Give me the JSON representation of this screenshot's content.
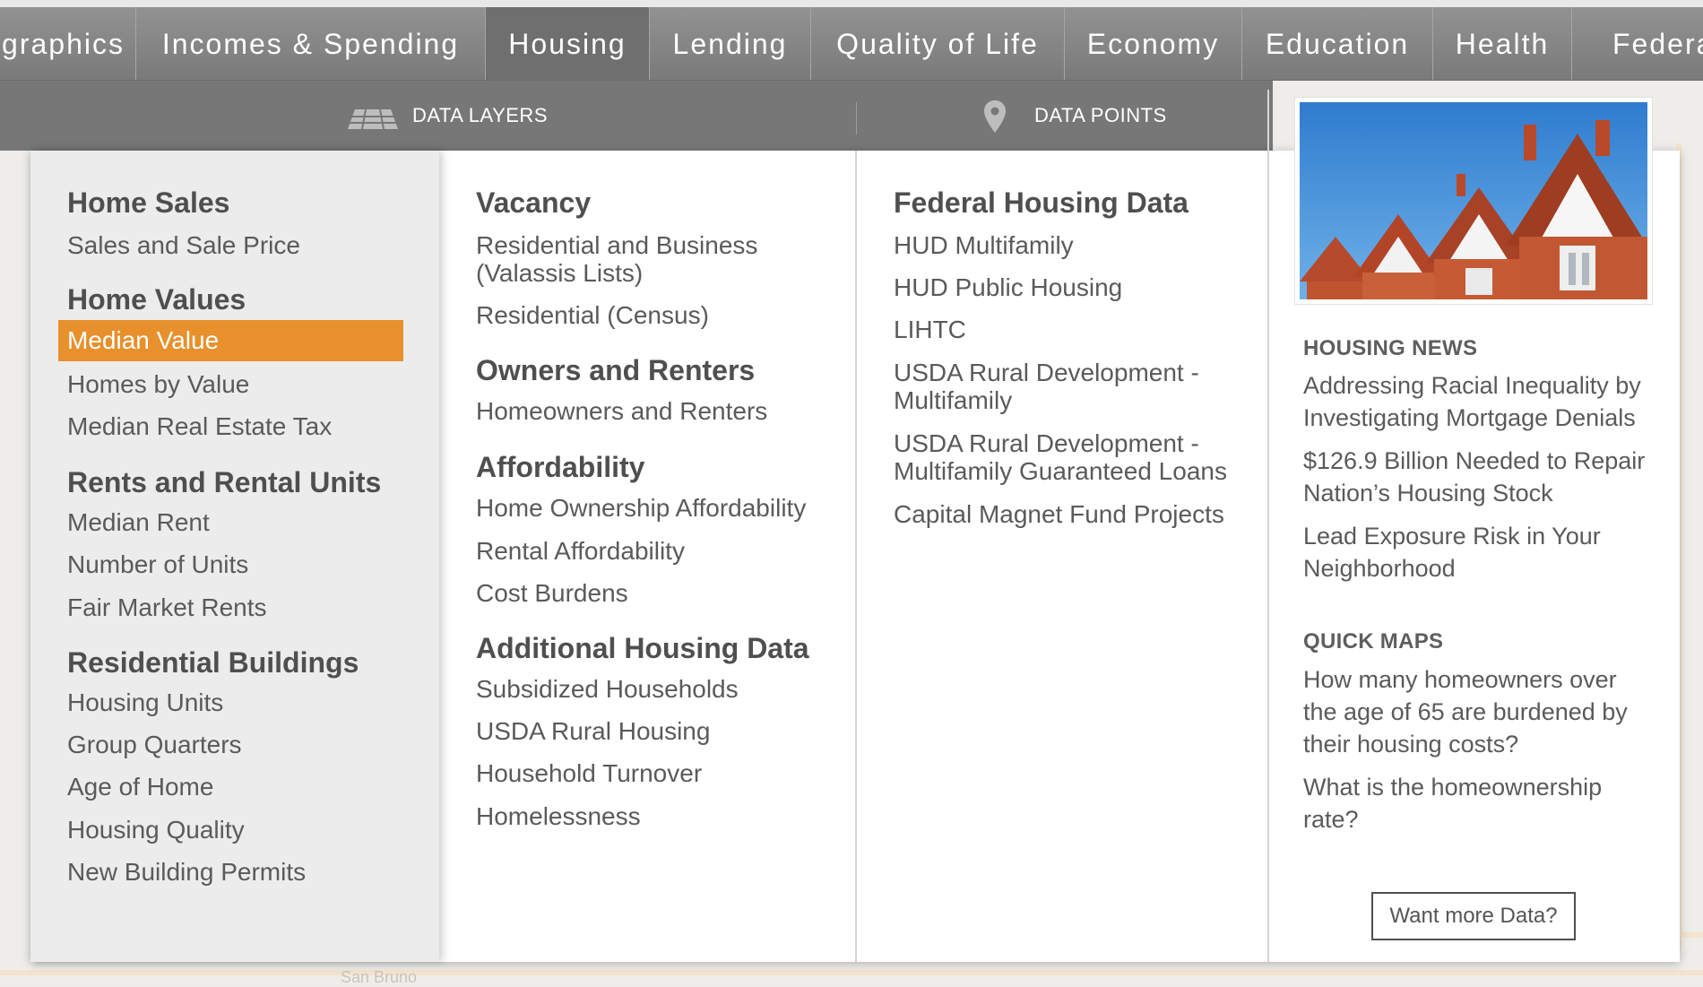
{
  "nav": {
    "tabs": [
      {
        "label": "graphics"
      },
      {
        "label": "Incomes & Spending"
      },
      {
        "label": "Housing"
      },
      {
        "label": "Lending"
      },
      {
        "label": "Quality of Life"
      },
      {
        "label": "Economy"
      },
      {
        "label": "Education"
      },
      {
        "label": "Health"
      },
      {
        "label": "Federal"
      }
    ],
    "active": "Housing"
  },
  "subnav": {
    "layers_label": "DATA LAYERS",
    "points_label": "DATA POINTS"
  },
  "col1": {
    "home_sales": {
      "title": "Home Sales",
      "items": [
        "Sales and Sale Price"
      ]
    },
    "home_values": {
      "title": "Home Values",
      "items": [
        "Median Value",
        "Homes by Value",
        "Median Real Estate Tax"
      ]
    },
    "rents": {
      "title": "Rents and Rental Units",
      "items": [
        "Median Rent",
        "Number of Units",
        "Fair Market Rents"
      ]
    },
    "buildings": {
      "title": "Residential Buildings",
      "items": [
        "Housing Units",
        "Group Quarters",
        "Age of Home",
        "Housing Quality",
        "New Building Permits"
      ]
    }
  },
  "col2": {
    "vacancy": {
      "title": "Vacancy",
      "items": [
        "Residential and Business",
        "(Valassis Lists)",
        "Residential (Census)"
      ]
    },
    "owners": {
      "title": "Owners and Renters",
      "items": [
        "Homeowners and Renters"
      ]
    },
    "afford": {
      "title": "Affordability",
      "items": [
        "Home Ownership Affordability",
        "Rental Affordability",
        "Cost Burdens"
      ]
    },
    "additional": {
      "title": "Additional Housing Data",
      "items": [
        "Subsidized Households",
        "USDA Rural Housing",
        "Household Turnover",
        "Homelessness"
      ]
    }
  },
  "col3": {
    "federal": {
      "title": "Federal Housing Data",
      "items": [
        "HUD Multifamily",
        "HUD Public Housing",
        "LIHTC",
        "USDA Rural Development -",
        "Multifamily",
        "USDA Rural Development -",
        "Multifamily Guaranteed Loans",
        "Capital Magnet Fund Projects"
      ]
    }
  },
  "news": {
    "title": "HOUSING NEWS",
    "items": [
      "Addressing Racial Inequality by Investigating Mortgage Denials",
      "$126.9 Billion Needed to Repair Nation’s Housing Stock",
      "Lead Exposure Risk in Your Neighborhood"
    ]
  },
  "quickmaps": {
    "title": "QUICK MAPS",
    "items": [
      "How many homeowners over the age of 65 are burdened by their housing costs?",
      "What is the homeownership rate?"
    ]
  },
  "cta": {
    "label": "Want more Data?"
  },
  "map": {
    "labels": [
      "San Bruno"
    ]
  }
}
